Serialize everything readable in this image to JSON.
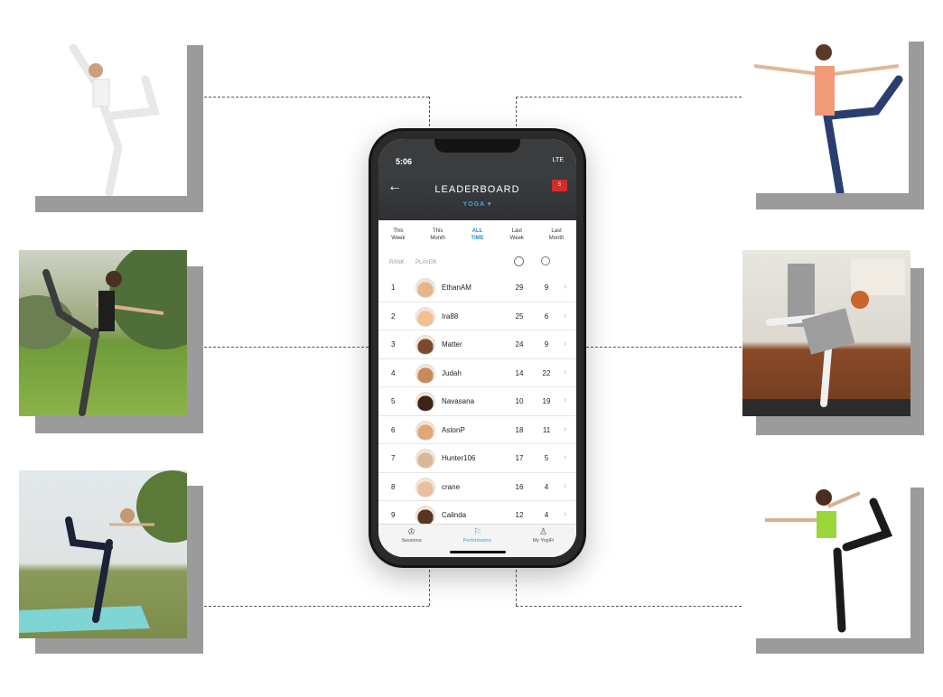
{
  "status": {
    "time": "5:06",
    "signal": "LTE"
  },
  "header": {
    "back": "←",
    "title": "LEADERBOARD",
    "subtitle": "YOGA ▾",
    "badge": "5"
  },
  "tabs": [
    {
      "line1": "This",
      "line2": "Week"
    },
    {
      "line1": "This",
      "line2": "Month"
    },
    {
      "line1": "ALL",
      "line2": "TIME"
    },
    {
      "line1": "Last",
      "line2": "Week"
    },
    {
      "line1": "Last",
      "line2": "Month"
    }
  ],
  "columns": {
    "rank": "RANK",
    "player": "PLAYER"
  },
  "rows": [
    {
      "rank": "1",
      "name": "EthanAM",
      "s1": "29",
      "s2": "9"
    },
    {
      "rank": "2",
      "name": "Ira88",
      "s1": "25",
      "s2": "6"
    },
    {
      "rank": "3",
      "name": "Matter",
      "s1": "24",
      "s2": "9"
    },
    {
      "rank": "4",
      "name": "Judah",
      "s1": "14",
      "s2": "22"
    },
    {
      "rank": "5",
      "name": "Navasana",
      "s1": "10",
      "s2": "19"
    },
    {
      "rank": "6",
      "name": "AstonP",
      "s1": "18",
      "s2": "11"
    },
    {
      "rank": "7",
      "name": "Hunter106",
      "s1": "17",
      "s2": "5"
    },
    {
      "rank": "8",
      "name": "crane",
      "s1": "16",
      "s2": "4"
    },
    {
      "rank": "9",
      "name": "Calinda",
      "s1": "12",
      "s2": "4"
    }
  ],
  "tabbar": [
    {
      "icon": "♔",
      "label": "Sessions"
    },
    {
      "icon": "⚐",
      "label": "Performance"
    },
    {
      "icon": "♙",
      "label": "My YogiFi"
    }
  ],
  "colors": {
    "accent": "#2a8fc9",
    "badge": "#d52b2b",
    "header": "#3a3c3e"
  }
}
